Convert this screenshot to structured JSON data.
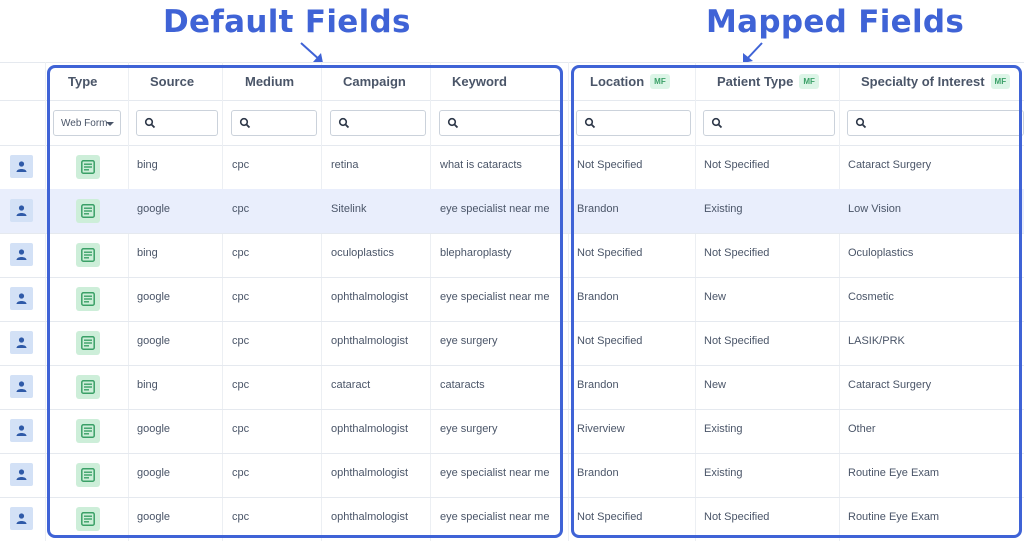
{
  "annotations": {
    "default_fields": "Default Fields",
    "mapped_fields": "Mapped Fields"
  },
  "columns": {
    "type": "Type",
    "source": "Source",
    "medium": "Medium",
    "campaign": "Campaign",
    "keyword": "Keyword",
    "location": "Location",
    "patient_type": "Patient Type",
    "specialty": "Specialty of Interest",
    "mf_badge": "MF"
  },
  "filters": {
    "type_selected": "Web Form",
    "search_icon": "search-icon"
  },
  "colors": {
    "annotation_blue": "#3f63d6",
    "highlight_row": "#e9eefc",
    "mf_badge_bg": "#dcf5e7",
    "mf_badge_text": "#3aa067"
  },
  "rows": [
    {
      "source": "bing",
      "medium": "cpc",
      "campaign": "retina",
      "keyword": "what is cataracts",
      "location": "Not Specified",
      "patient_type": "Not Specified",
      "specialty": "Cataract Surgery"
    },
    {
      "source": "google",
      "medium": "cpc",
      "campaign": "Sitelink",
      "keyword": "eye specialist near me",
      "location": "Brandon",
      "patient_type": "Existing",
      "specialty": "Low Vision"
    },
    {
      "source": "bing",
      "medium": "cpc",
      "campaign": "oculoplastics",
      "keyword": "blepharoplasty",
      "location": "Not Specified",
      "patient_type": "Not Specified",
      "specialty": "Oculoplastics"
    },
    {
      "source": "google",
      "medium": "cpc",
      "campaign": "ophthalmologist",
      "keyword": "eye specialist near me",
      "location": "Brandon",
      "patient_type": "New",
      "specialty": "Cosmetic"
    },
    {
      "source": "google",
      "medium": "cpc",
      "campaign": "ophthalmologist",
      "keyword": "eye surgery",
      "location": "Not Specified",
      "patient_type": "Not Specified",
      "specialty": "LASIK/PRK"
    },
    {
      "source": "bing",
      "medium": "cpc",
      "campaign": "cataract",
      "keyword": "cataracts",
      "location": "Brandon",
      "patient_type": "New",
      "specialty": "Cataract Surgery"
    },
    {
      "source": "google",
      "medium": "cpc",
      "campaign": "ophthalmologist",
      "keyword": "eye surgery",
      "location": "Riverview",
      "patient_type": "Existing",
      "specialty": "Other"
    },
    {
      "source": "google",
      "medium": "cpc",
      "campaign": "ophthalmologist",
      "keyword": "eye specialist near me",
      "location": "Brandon",
      "patient_type": "Existing",
      "specialty": "Routine Eye Exam"
    },
    {
      "source": "google",
      "medium": "cpc",
      "campaign": "ophthalmologist",
      "keyword": "eye specialist near me",
      "location": "Not Specified",
      "patient_type": "Not Specified",
      "specialty": "Routine Eye Exam"
    }
  ]
}
